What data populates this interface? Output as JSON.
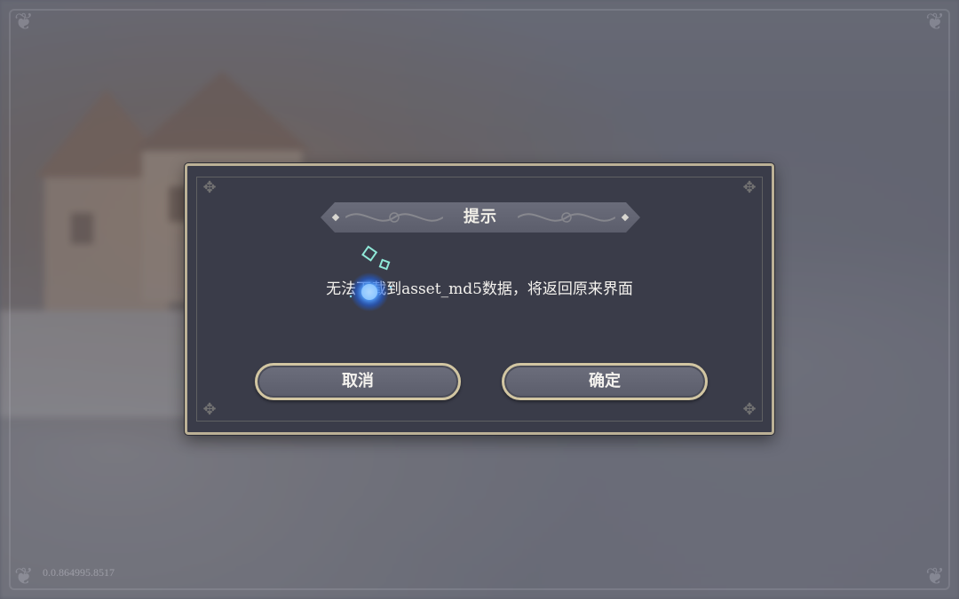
{
  "dialog": {
    "title": "提示",
    "message": "无法下载到asset_md5数据，将返回原来界面",
    "cancel_label": "取消",
    "confirm_label": "确定"
  },
  "footer": {
    "version": "0.0.864995.8517"
  },
  "colors": {
    "dialog_background": "#3a3c49",
    "dialog_border": "#bcb196",
    "button_border": "#d2c6a2",
    "orb_glow": "#3f8cff"
  },
  "icons": {
    "loading": "loading-orb-icon"
  }
}
